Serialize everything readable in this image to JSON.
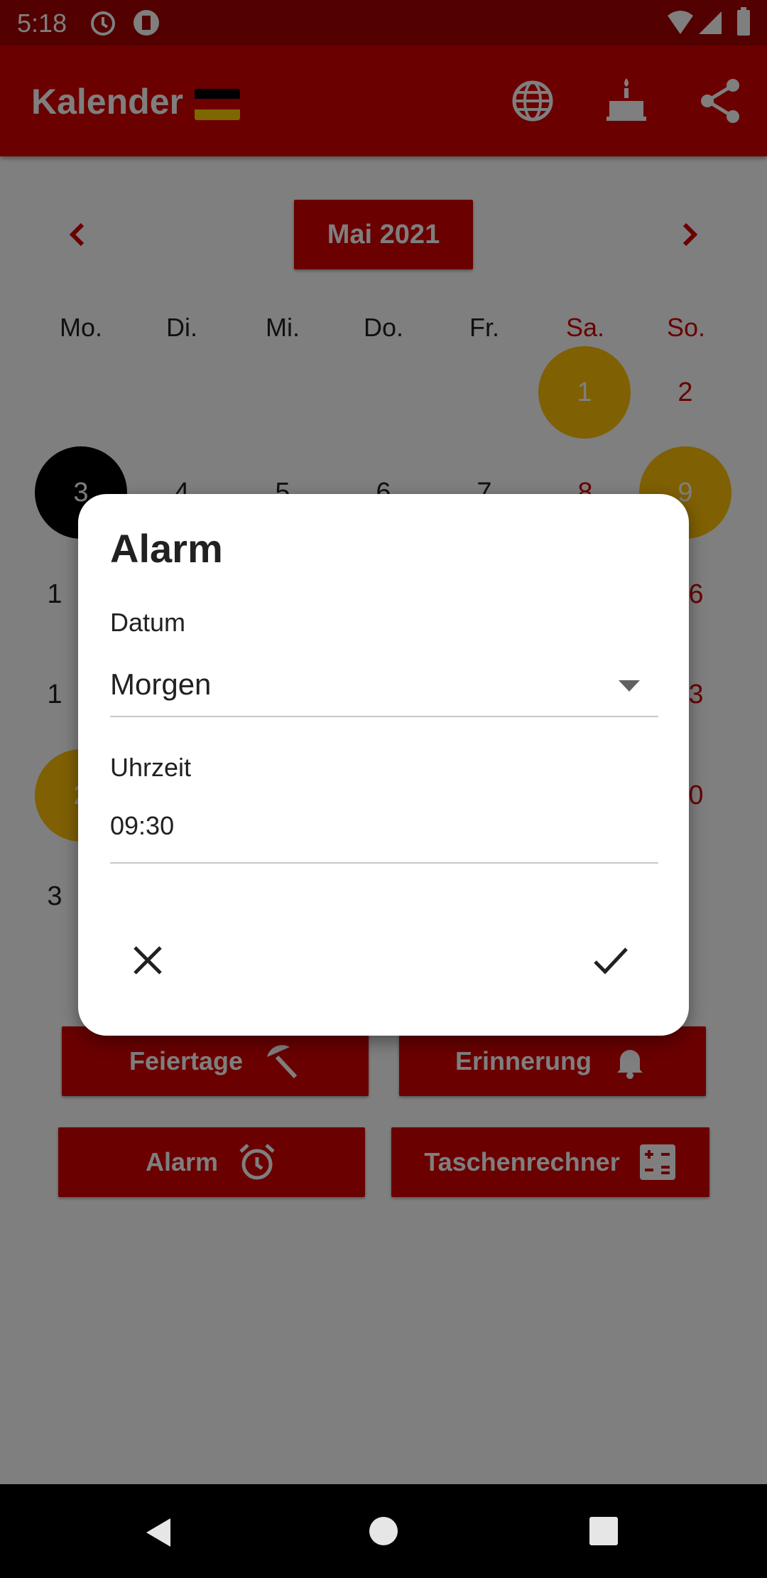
{
  "status_bar": {
    "time": "5:18"
  },
  "app_bar": {
    "title": "Kalender",
    "icons": [
      "globe-icon",
      "cake-icon",
      "share-icon"
    ]
  },
  "calendar": {
    "month_label": "Mai 2021",
    "weekdays": [
      "Mo.",
      "Di.",
      "Mi.",
      "Do.",
      "Fr.",
      "Sa.",
      "So."
    ],
    "week1": [
      "1",
      "2"
    ],
    "week2": [
      "3",
      "4",
      "5",
      "6",
      "7",
      "8",
      "9"
    ],
    "visible_partial": [
      "1",
      "6",
      "1",
      "3",
      "2",
      "0",
      "3"
    ]
  },
  "actions": {
    "holidays": "Feiertage",
    "reminder": "Erinnerung",
    "alarm": "Alarm",
    "calculator": "Taschenrechner"
  },
  "dialog": {
    "title": "Alarm",
    "date_label": "Datum",
    "date_value": "Morgen",
    "time_label": "Uhrzeit",
    "time_value": "09:30"
  },
  "colors": {
    "primary": "#d50000",
    "status_bar": "#a40000",
    "holiday": "#ffc107",
    "today": "#000000"
  }
}
